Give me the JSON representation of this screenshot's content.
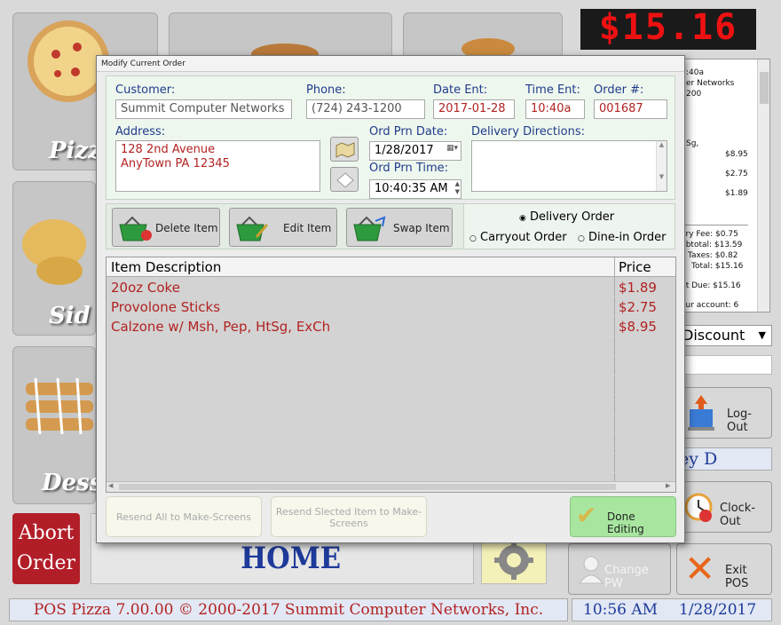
{
  "total_display": "$15.16",
  "categories": [
    {
      "label": "Pizz"
    },
    {
      "label": "Sid"
    },
    {
      "label": "Dess"
    }
  ],
  "abort_button": {
    "line1": "Abort",
    "line2": "Order"
  },
  "home_label": "HOME",
  "receipt": {
    "header_lines": [
      ":40a",
      "er Networks",
      "200"
    ],
    "items": [
      {
        "name": "Sg,",
        "price": "$8.95"
      },
      {
        "name": "",
        "price": "$2.75"
      },
      {
        "name": "",
        "price": "$1.89"
      }
    ],
    "summary": [
      "ery Fee: $0.75",
      "ubtotal: $13.59",
      "Taxes: $0.82",
      "Total: $15.16",
      "nt Due: $15.16",
      "our account: 6"
    ]
  },
  "discount_select": "Discount",
  "employee_name": "ey D",
  "right_buttons": {
    "logout": "Log-Out",
    "clockout": "Clock-Out",
    "changepw": "Change PW",
    "exitpos": "Exit POS"
  },
  "footer": {
    "copyright": "POS Pizza 7.00.00 © 2000-2017 Summit Computer Networks, Inc.",
    "time": "10:56 AM",
    "date": "1/28/2017"
  },
  "dialog": {
    "title": "Modify Current Order",
    "customer_label": "Customer:",
    "customer_value": "Summit Computer Networks",
    "phone_label": "Phone:",
    "phone_value": "(724) 243-1200",
    "date_ent_label": "Date Ent:",
    "date_ent_value": "2017-01-28",
    "time_ent_label": "Time Ent:",
    "time_ent_value": "10:40a",
    "order_label": "Order #:",
    "order_value": "001687",
    "address_label": "Address:",
    "address_line1": "128 2nd Avenue",
    "address_line2": "AnyTown PA  12345",
    "prn_date_label": "Ord Prn Date:",
    "prn_date_value": "1/28/2017",
    "prn_time_label": "Ord Prn Time:",
    "prn_time_value": "10:40:35 AM",
    "delivery_dir_label": "Delivery Directions:",
    "delete_item": "Delete Item",
    "edit_item": "Edit Item",
    "swap_item": "Swap Item",
    "order_types": [
      "Delivery Order",
      "Carryout Order",
      "Dine-in Order"
    ],
    "selected_order_type": "Delivery Order",
    "col_desc": "Item Description",
    "col_price": "Price",
    "items": [
      {
        "desc": "20oz Coke",
        "price": "$1.89"
      },
      {
        "desc": "Provolone Sticks",
        "price": "$2.75"
      },
      {
        "desc": "Calzone w/ Msh, Pep, HtSg, ExCh",
        "price": "$8.95"
      }
    ],
    "resend_all": "Resend All to Make-Screens",
    "resend_selected": "Resend Slected Item to Make-Screens",
    "done_editing": "Done Editing"
  },
  "colors": {
    "accent_red": "#b22222",
    "label_blue": "#1f3b8a",
    "done_green": "#a8e6a0",
    "led_red": "#e11111"
  }
}
